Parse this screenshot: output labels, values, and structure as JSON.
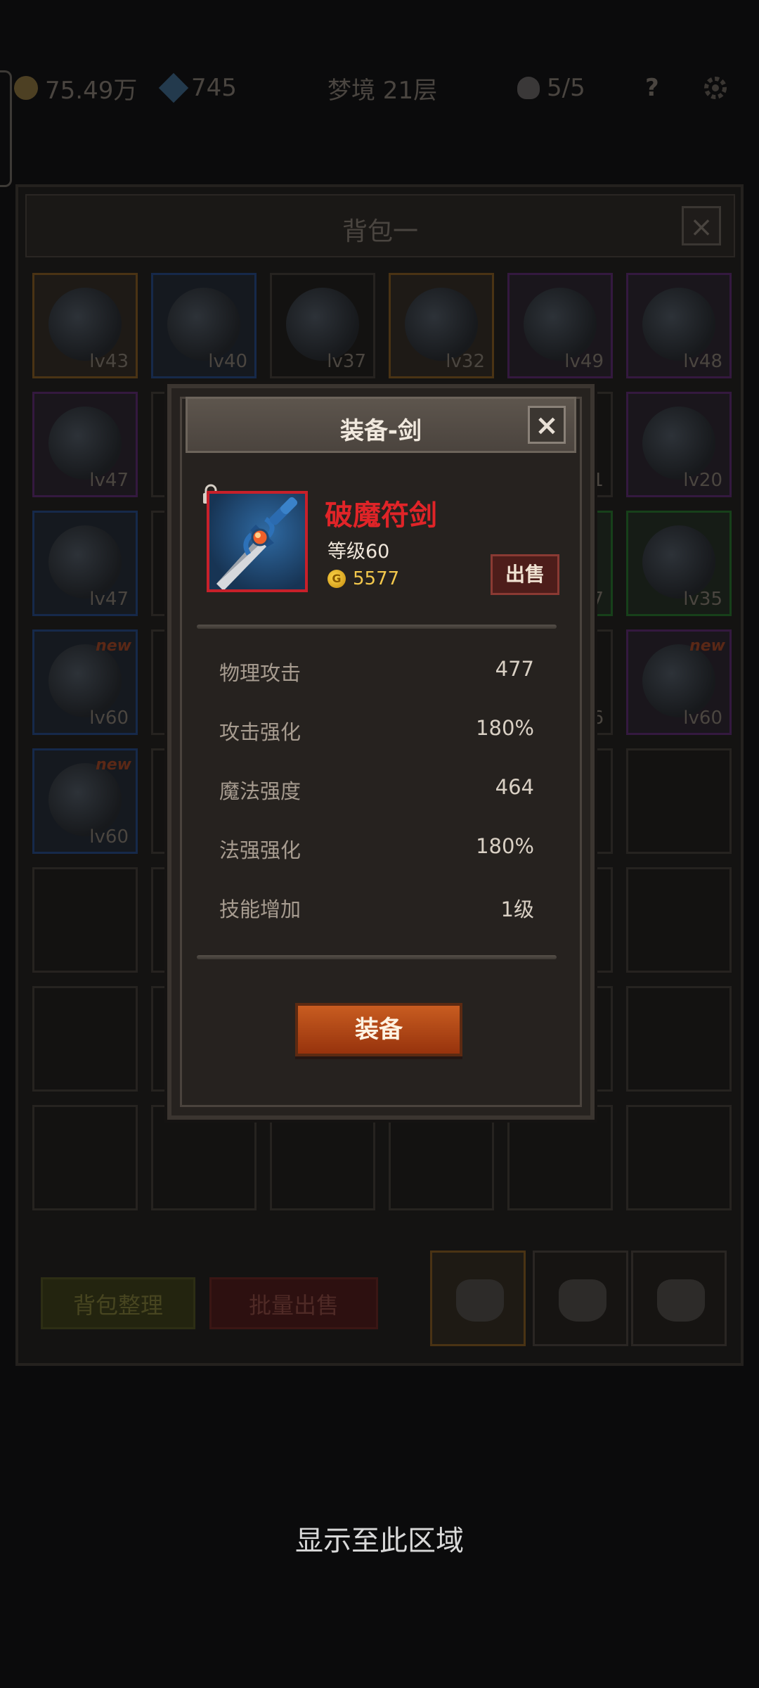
{
  "top_bar": {
    "gold": "75.49万",
    "gems": "745",
    "floor": "梦境 21层",
    "lives": "5/5",
    "help": "?"
  },
  "bag": {
    "title": "背包一",
    "close": "×",
    "sort_label": "背包整理",
    "bulk_sell_label": "批量出售",
    "slots": [
      {
        "lv": "lv43",
        "color": "orange",
        "icon": "gauntlet-icon"
      },
      {
        "lv": "lv40",
        "color": "blue",
        "icon": "round-shield-icon"
      },
      {
        "lv": "lv37",
        "color": "",
        "icon": "helmet-icon"
      },
      {
        "lv": "lv32",
        "color": "orange",
        "icon": "sword-icon"
      },
      {
        "lv": "lv49",
        "color": "purple",
        "icon": "dagger-icon"
      },
      {
        "lv": "lv48",
        "color": "purple",
        "icon": "pauldron-icon"
      },
      {
        "lv": "lv47",
        "color": "purple",
        "icon": "trident-icon"
      },
      {
        "lv": "",
        "color": "",
        "icon": ""
      },
      {
        "lv": "",
        "color": "",
        "icon": ""
      },
      {
        "lv": "",
        "color": "",
        "icon": ""
      },
      {
        "lv": "1",
        "color": "",
        "icon": ""
      },
      {
        "lv": "lv20",
        "color": "purple",
        "icon": "wooden-shield-icon"
      },
      {
        "lv": "lv47",
        "color": "blue",
        "icon": "gauntlet-icon"
      },
      {
        "lv": "",
        "color": "",
        "icon": ""
      },
      {
        "lv": "",
        "color": "",
        "icon": ""
      },
      {
        "lv": "",
        "color": "",
        "icon": ""
      },
      {
        "lv": "7",
        "color": "green",
        "icon": ""
      },
      {
        "lv": "lv35",
        "color": "green",
        "icon": "ring-icon"
      },
      {
        "lv": "lv60",
        "color": "blue",
        "icon": "mesh-orb-icon",
        "new": "new"
      },
      {
        "lv": "",
        "color": "",
        "icon": ""
      },
      {
        "lv": "",
        "color": "",
        "icon": ""
      },
      {
        "lv": "",
        "color": "",
        "icon": ""
      },
      {
        "lv": "6",
        "color": "",
        "icon": ""
      },
      {
        "lv": "lv60",
        "color": "purple",
        "icon": "blade-icon",
        "new": "new"
      },
      {
        "lv": "lv60",
        "color": "blue",
        "icon": "chest-armor-icon",
        "new": "new"
      },
      {
        "lv": "",
        "color": "",
        "icon": ""
      },
      {
        "lv": "",
        "color": "",
        "icon": ""
      },
      {
        "lv": "",
        "color": "",
        "icon": ""
      },
      {
        "lv": "",
        "color": "",
        "icon": ""
      },
      {
        "lv": "",
        "color": "",
        "icon": ""
      },
      {
        "lv": "",
        "color": "",
        "icon": ""
      },
      {
        "lv": "",
        "color": "",
        "icon": ""
      },
      {
        "lv": "",
        "color": "",
        "icon": ""
      },
      {
        "lv": "",
        "color": "",
        "icon": ""
      },
      {
        "lv": "",
        "color": "",
        "icon": ""
      },
      {
        "lv": "",
        "color": "",
        "icon": ""
      },
      {
        "lv": "",
        "color": "",
        "icon": ""
      },
      {
        "lv": "",
        "color": "",
        "icon": ""
      },
      {
        "lv": "",
        "color": "",
        "icon": ""
      },
      {
        "lv": "",
        "color": "",
        "icon": ""
      },
      {
        "lv": "",
        "color": "",
        "icon": ""
      },
      {
        "lv": "",
        "color": "",
        "icon": ""
      },
      {
        "lv": "",
        "color": "",
        "icon": ""
      },
      {
        "lv": "",
        "color": "",
        "icon": ""
      },
      {
        "lv": "",
        "color": "",
        "icon": ""
      },
      {
        "lv": "",
        "color": "",
        "icon": ""
      },
      {
        "lv": "",
        "color": "",
        "icon": ""
      },
      {
        "lv": "",
        "color": "",
        "icon": ""
      }
    ],
    "tabs": [
      "bag-tab-1",
      "bag-tab-2",
      "bag-tab-3"
    ]
  },
  "dialog": {
    "title": "装备-剑",
    "close": "×",
    "item_name": "破魔符剑",
    "item_level": "等级60",
    "gold_symbol": "G",
    "price": "5577",
    "sell_label": "出售",
    "stats": [
      {
        "name": "物理攻击",
        "value": "477"
      },
      {
        "name": "攻击强化",
        "value": "180%"
      },
      {
        "name": "魔法强度",
        "value": "464"
      },
      {
        "name": "法强强化",
        "value": "180%"
      },
      {
        "name": "技能增加",
        "value": "1级"
      }
    ],
    "equip_label": "装备"
  },
  "hint": "显示至此区域",
  "colors": {
    "rarity_red": "#c8202a",
    "item_name_red": "#e02428",
    "gold": "#f3c84c",
    "equip_orange": "#c85c20"
  }
}
